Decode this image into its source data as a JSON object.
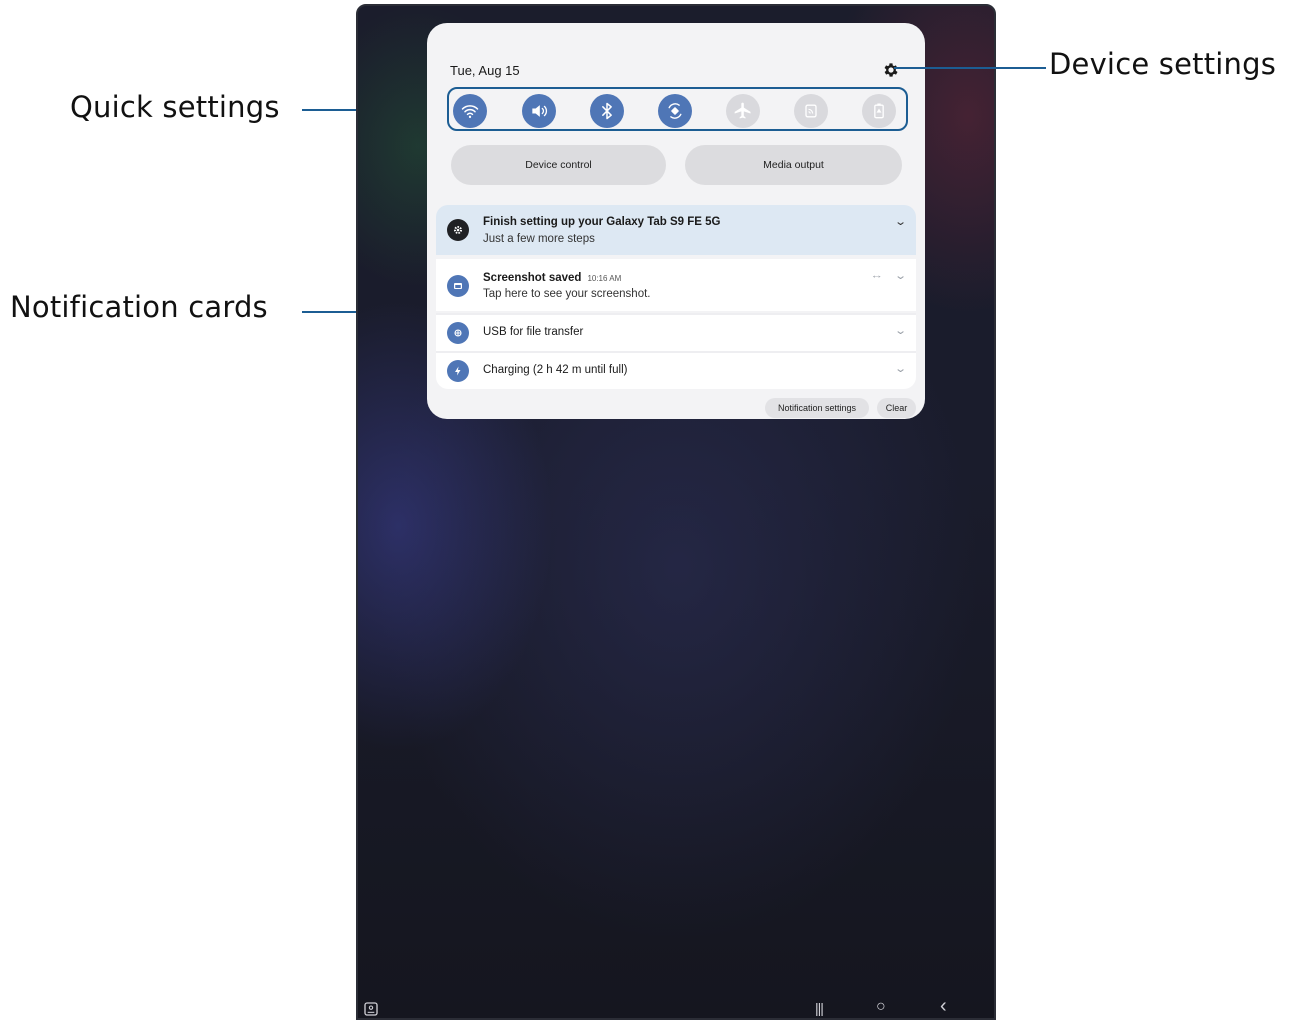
{
  "callouts": {
    "quick_settings": "Quick settings",
    "notification_cards": "Notification cards",
    "device_settings": "Device settings",
    "line_color": "#1c5d93"
  },
  "panel": {
    "date": "Tue, Aug 15",
    "settings_icon": "gear-icon",
    "quick_settings": [
      {
        "name": "wifi",
        "icon": "wifi-icon",
        "state": "on"
      },
      {
        "name": "sound",
        "icon": "volume-icon",
        "state": "on"
      },
      {
        "name": "bluetooth",
        "icon": "bluetooth-icon",
        "state": "on"
      },
      {
        "name": "auto rotate",
        "icon": "rotate-icon",
        "state": "on"
      },
      {
        "name": "airplane mode",
        "icon": "airplane-icon",
        "state": "off"
      },
      {
        "name": "mobile data",
        "icon": "mobile-data-icon",
        "state": "off"
      },
      {
        "name": "power saving",
        "icon": "battery-icon",
        "state": "off"
      }
    ],
    "device_control_label": "Device control",
    "media_output_label": "Media output"
  },
  "notifications": [
    {
      "title": "Finish setting up your Galaxy Tab S9 FE 5G",
      "subtitle": "Just a few more steps",
      "icon": "settings-icon"
    },
    {
      "title": "Screenshot saved",
      "time": "10:16 AM",
      "subtitle": "Tap here to see your screenshot.",
      "icon": "screenshot-icon"
    },
    {
      "title": "USB for file transfer",
      "icon": "usb-icon"
    },
    {
      "title": "Charging (2 h 42 m until full)",
      "icon": "charging-icon"
    }
  ],
  "footer": {
    "notification_settings_label": "Notification settings",
    "clear_label": "Clear"
  },
  "navbar": {
    "recents": "|||",
    "home": "○",
    "back": "‹"
  },
  "colors": {
    "accent": "#4f76b6",
    "highlight": "#dde8f3",
    "panel": "#f3f3f5"
  }
}
